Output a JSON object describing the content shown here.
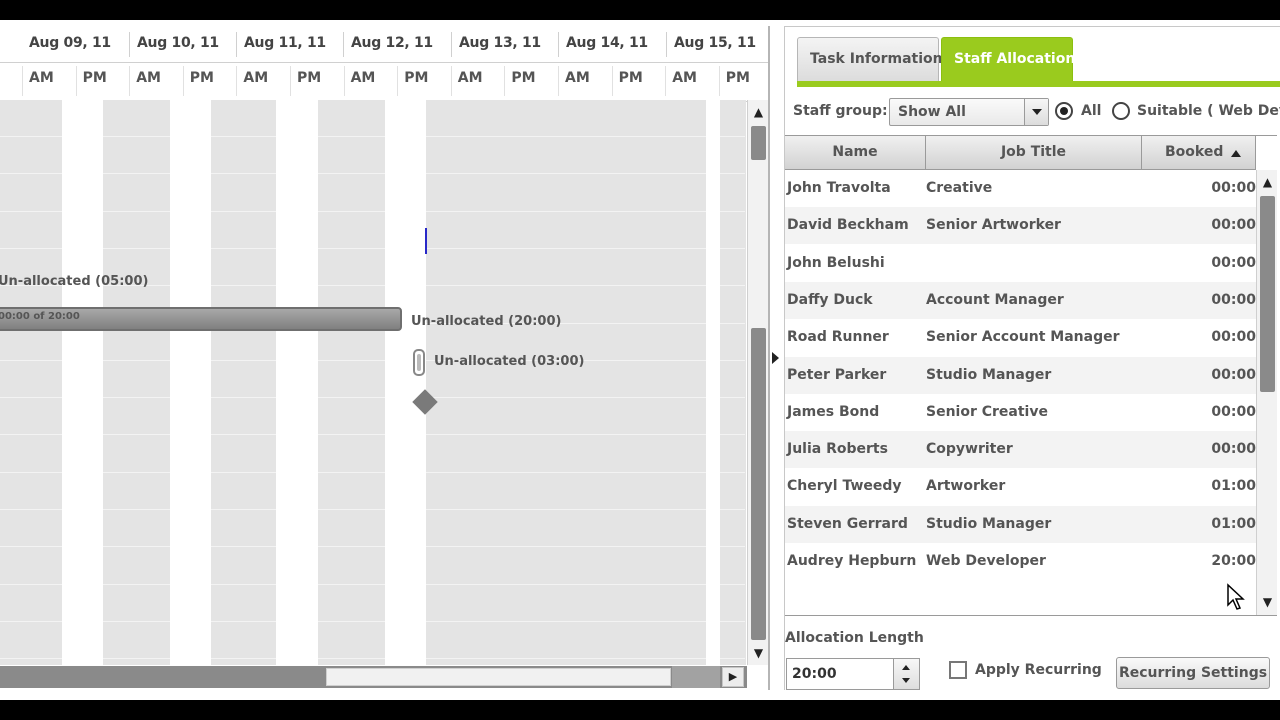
{
  "gantt": {
    "dates": [
      "Aug 09, 11",
      "Aug 10, 11",
      "Aug 11, 11",
      "Aug 12, 11",
      "Aug 13, 11",
      "Aug 14, 11",
      "Aug 15, 11"
    ],
    "half_day_labels": [
      "AM",
      "PM",
      "AM",
      "PM",
      "AM",
      "PM",
      "AM",
      "PM",
      "AM",
      "PM",
      "AM",
      "PM",
      "AM",
      "PM"
    ],
    "task_label": "Un-allocated (05:00)",
    "task_bar_text": "00:00 of 20:00",
    "bar_label": "Un-allocated (20:00)",
    "pill_label": "Un-allocated (03:00)"
  },
  "panel": {
    "tabs": [
      {
        "label": "Task Information",
        "active": false
      },
      {
        "label": "Staff Allocation",
        "active": true
      }
    ],
    "staff_group_label": "Staff group:",
    "staff_group_value": "Show All",
    "radio_all_label": "All",
    "radio_suitable_label": "Suitable ( Web Develo",
    "table": {
      "columns": [
        "Name",
        "Job Title",
        "Booked"
      ],
      "sorted_by": "Booked",
      "rows": [
        {
          "name": "John Travolta",
          "job": "Creative",
          "booked": "00:00"
        },
        {
          "name": "David Beckham",
          "job": "Senior Artworker",
          "booked": "00:00"
        },
        {
          "name": "John Belushi",
          "job": "",
          "booked": "00:00"
        },
        {
          "name": "Daffy Duck",
          "job": "Account Manager",
          "booked": "00:00"
        },
        {
          "name": "Road Runner",
          "job": "Senior Account Manager",
          "booked": "00:00"
        },
        {
          "name": "Peter Parker",
          "job": "Studio Manager",
          "booked": "00:00"
        },
        {
          "name": "James Bond",
          "job": "Senior Creative",
          "booked": "00:00"
        },
        {
          "name": "Julia Roberts",
          "job": "Copywriter",
          "booked": "00:00"
        },
        {
          "name": "Cheryl Tweedy",
          "job": "Artworker",
          "booked": "01:00"
        },
        {
          "name": "Steven Gerrard",
          "job": "Studio Manager",
          "booked": "01:00"
        },
        {
          "name": "Audrey Hepburn",
          "job": "Web Developer",
          "booked": "20:00"
        }
      ]
    },
    "allocation_length_label": "Allocation Length",
    "allocation_length_value": "20:00",
    "apply_recurring_label": "Apply Recurring",
    "recurring_settings_label": "Recurring Settings"
  },
  "colors": {
    "accent": "#9acb1e",
    "milestone": "#2828c8"
  }
}
